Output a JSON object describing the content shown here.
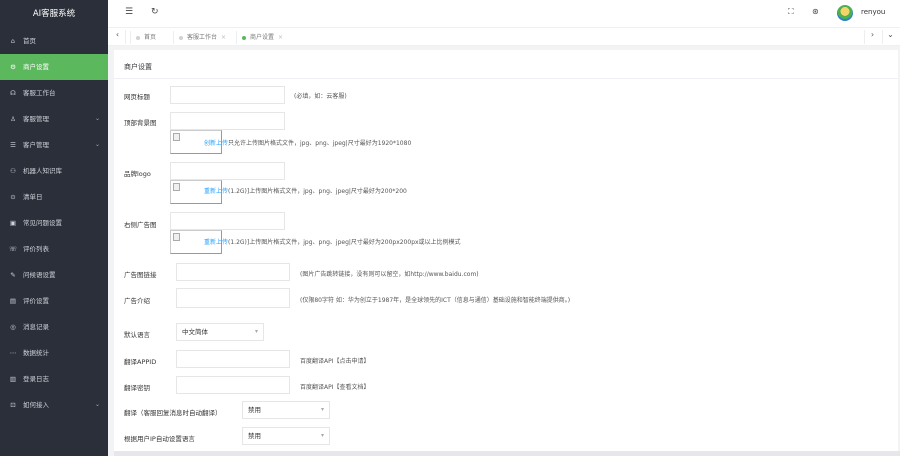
{
  "app": {
    "title": "AI客服系统"
  },
  "sidebar": {
    "items": [
      {
        "label": "首页",
        "icon": "home-icon",
        "glyph": "⌂",
        "active": false,
        "chevron": false
      },
      {
        "label": "商户设置",
        "icon": "settings-icon",
        "glyph": "⚙",
        "active": true,
        "chevron": false
      },
      {
        "label": "客服工作台",
        "icon": "headset-icon",
        "glyph": "☊",
        "active": false,
        "chevron": false
      },
      {
        "label": "客服管理",
        "icon": "user-icon",
        "glyph": "♙",
        "active": false,
        "chevron": true
      },
      {
        "label": "客户管理",
        "icon": "list-icon",
        "glyph": "☰",
        "active": false,
        "chevron": true
      },
      {
        "label": "机器人知识库",
        "icon": "robot-icon",
        "glyph": "⚇",
        "active": false,
        "chevron": false
      },
      {
        "label": "清单日",
        "icon": "calendar-icon",
        "glyph": "⊙",
        "active": false,
        "chevron": false
      },
      {
        "label": "常见问题设置",
        "icon": "question-icon",
        "glyph": "▣",
        "active": false,
        "chevron": false
      },
      {
        "label": "评价列表",
        "icon": "comment-icon",
        "glyph": "☏",
        "active": false,
        "chevron": false
      },
      {
        "label": "问候语设置",
        "icon": "edit-icon",
        "glyph": "✎",
        "active": false,
        "chevron": false
      },
      {
        "label": "评价设置",
        "icon": "grid-icon",
        "glyph": "▤",
        "active": false,
        "chevron": false
      },
      {
        "label": "消息记录",
        "icon": "message-icon",
        "glyph": "◎",
        "active": false,
        "chevron": false
      },
      {
        "label": "数据统计",
        "icon": "chart-icon",
        "glyph": "⋯",
        "active": false,
        "chevron": false
      },
      {
        "label": "登录日志",
        "icon": "log-icon",
        "glyph": "▥",
        "active": false,
        "chevron": false
      },
      {
        "label": "如何接入",
        "icon": "link-icon",
        "glyph": "⊡",
        "active": false,
        "chevron": true
      }
    ]
  },
  "header": {
    "menu_icon": "☰",
    "refresh_icon": "↻",
    "fullscreen_icon": "⛶",
    "theme_icon": "⊛",
    "username": "renyou"
  },
  "tabs": {
    "prev_icon": "‹",
    "next_icon": "›",
    "more_icon": "⌄",
    "items": [
      {
        "label": "首页",
        "active": false
      },
      {
        "label": "客服工作台",
        "active": false
      },
      {
        "label": "商户设置",
        "active": true
      }
    ],
    "close_glyph": "×"
  },
  "form": {
    "title": "商户设置",
    "fields": {
      "page_title": {
        "label": "网页标题",
        "value": "",
        "hint": "(必填，如：云客服)"
      },
      "top_bg": {
        "label": "顶部背景图",
        "value": "",
        "upload_link": "创新上传",
        "upload_hint": "只允许上传图片格式文件，jpg、png、jpeg|尺寸最好为1920*1080"
      },
      "brand_logo": {
        "label": "品牌logo",
        "value": "",
        "upload_link": "重新上传",
        "upload_hint": "(1.2G)]上传图片格式文件，jpg、png、jpeg|尺寸最好为200*200"
      },
      "right_ad": {
        "label": "右侧广告图",
        "value": "",
        "upload_link": "重新上传",
        "upload_hint": "(1.2G)]上传图片格式文件，jpg、png、jpeg|尺寸最好为200px200px或以上比例模式"
      },
      "ad_link": {
        "label": "广告图链接",
        "value": "",
        "hint": "(图片广告跳转链接，没有则可以留空，如http://www.baidu.com)"
      },
      "ad_intro": {
        "label": "广告介绍",
        "value": "",
        "hint": "(仅限80字符 如：华为创立于1987年，是全球领先的ICT（信息与通信）基础设施和智能终端提供商。)"
      },
      "default_lang": {
        "label": "默认语言",
        "value": "中文简体"
      },
      "translate_appid": {
        "label": "翻译APPID",
        "value": "",
        "hint": "百度翻译API【点击申请】"
      },
      "translate_secret": {
        "label": "翻译密钥",
        "value": "",
        "hint": "百度翻译API【查看文档】"
      },
      "auto_translate": {
        "label": "翻译（客服回复消息时自动翻译）",
        "value": "禁用"
      },
      "ip_lang": {
        "label": "根据用户IP自动设置语言",
        "value": "禁用"
      }
    }
  }
}
